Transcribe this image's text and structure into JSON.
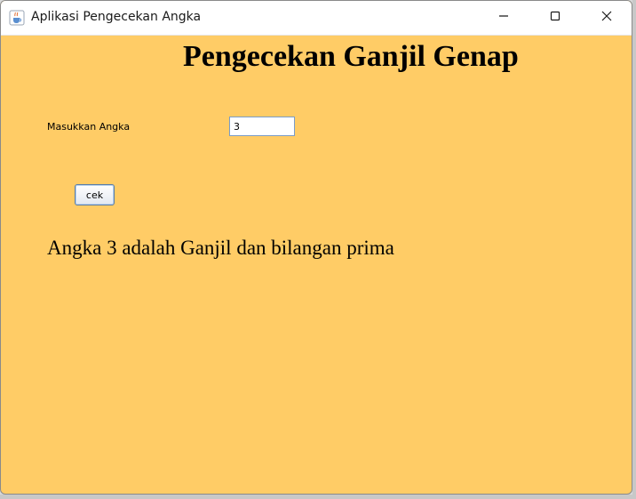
{
  "window": {
    "title": "Aplikasi Pengecekan Angka",
    "background_color": "#ffcc66"
  },
  "titlebar_icons": {
    "app": "java-cup-icon",
    "minimize": "minimize-icon",
    "maximize": "maximize-icon",
    "close": "close-icon"
  },
  "main": {
    "heading": "Pengecekan Ganjil Genap",
    "input_label": "Masukkan Angka",
    "input_value": "3",
    "check_button_label": "cek",
    "result": "Angka 3 adalah Ganjil dan bilangan prima"
  }
}
